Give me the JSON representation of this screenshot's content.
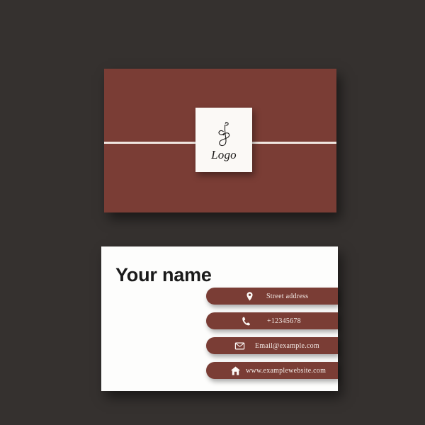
{
  "theme": {
    "background_color": "#35312F",
    "brand_brown": "#7A3D35",
    "card_white": "#FDFDFC",
    "stripe_color": "#F0E6E0",
    "bar_text_color": "#F4ECE8",
    "name_color": "#1A1A1A"
  },
  "back_card": {
    "logo": {
      "mark_icon": "script-monogram-icon",
      "word": "Logo"
    }
  },
  "front_card": {
    "name": "Your name",
    "contacts": [
      {
        "icon": "location-pin-icon",
        "label": "Street address"
      },
      {
        "icon": "phone-icon",
        "label": "+12345678"
      },
      {
        "icon": "envelope-icon",
        "label": "Email@example.com"
      },
      {
        "icon": "home-icon",
        "label": "www.examplewebsite.com"
      }
    ]
  }
}
